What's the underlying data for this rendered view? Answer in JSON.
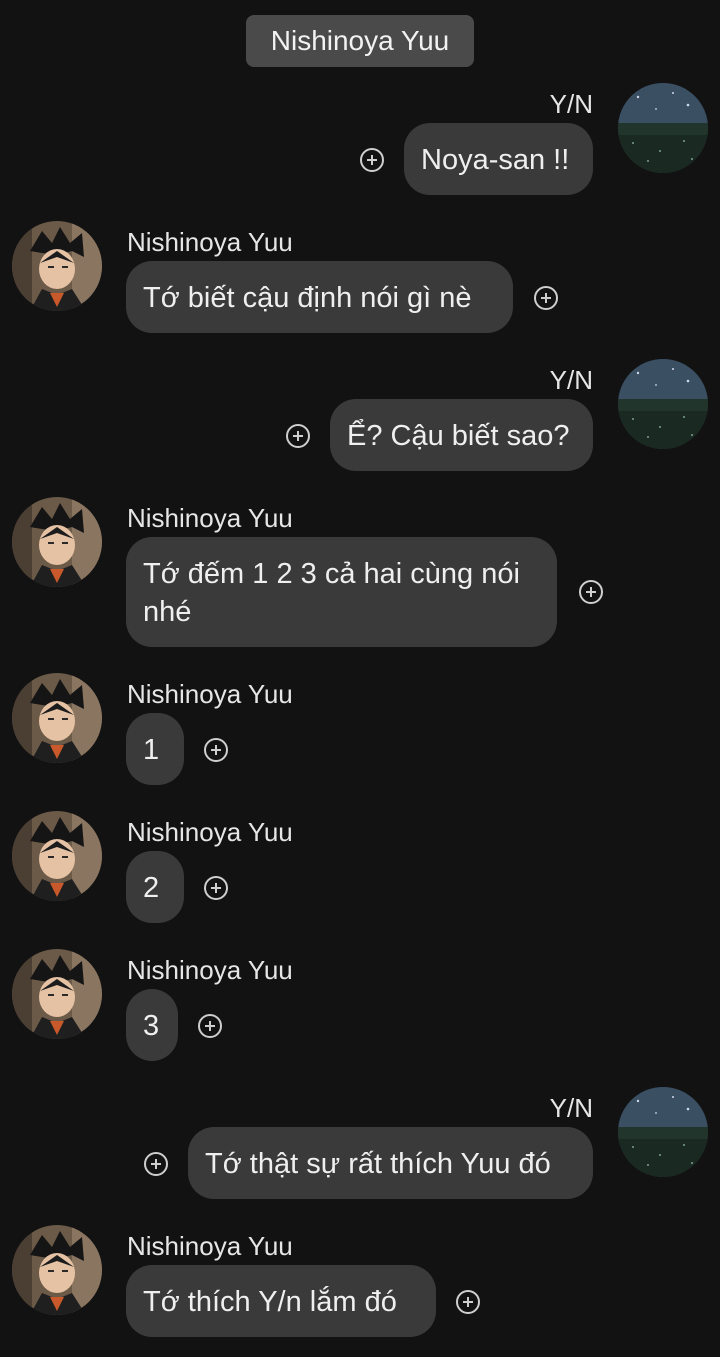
{
  "header": {
    "title": "Nishinoya Yuu"
  },
  "messages": [
    {
      "sender": "Y/N",
      "text": "Noya-san !!",
      "side": "right"
    },
    {
      "sender": "Nishinoya Yuu",
      "text": "Tớ biết cậu định nói gì nè",
      "side": "left"
    },
    {
      "sender": "Y/N",
      "text": "Ể? Cậu biết sao?",
      "side": "right"
    },
    {
      "sender": "Nishinoya Yuu",
      "text": "Tớ đếm 1 2 3 cả hai cùng nói nhé",
      "side": "left"
    },
    {
      "sender": "Nishinoya Yuu",
      "text": "1",
      "side": "left"
    },
    {
      "sender": "Nishinoya Yuu",
      "text": "2",
      "side": "left"
    },
    {
      "sender": "Nishinoya Yuu",
      "text": "3",
      "side": "left"
    },
    {
      "sender": "Y/N",
      "text": "Tớ thật sự rất thích Yuu đó",
      "side": "right"
    },
    {
      "sender": "Nishinoya Yuu",
      "text": "Tớ thích Y/n lắm đó",
      "side": "left"
    }
  ],
  "colors": {
    "background": "#121212",
    "bubble": "#3a3a3a",
    "header_pill": "#4a4a4a"
  },
  "icons": {
    "react": "add-reaction-icon",
    "avatar_yn": "night-sky-field-avatar",
    "avatar_noya": "anime-boy-avatar"
  }
}
